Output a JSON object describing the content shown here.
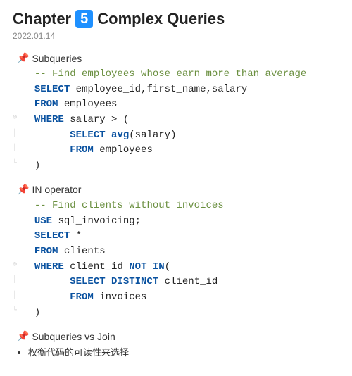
{
  "title": {
    "prefix": "Chapter",
    "number": "5",
    "suffix": "Complex Queries"
  },
  "date": "2022.01.14",
  "sections": {
    "s1": {
      "heading": "Subqueries",
      "code_html": "  <span class=\"cmt\">-- Find employees whose earn more than average</span>\n  <span class=\"kw\">SELECT</span> <span class=\"id\">employee_id,first_name,salary</span>\n  <span class=\"kw\">FROM</span> <span class=\"id\">employees</span>\n<span class=\"gutter\">⊖</span>  <span class=\"kw\">WHERE</span> <span class=\"id\">salary &gt; (</span>\n<span class=\"gutter\">│</span>        <span class=\"kw\">SELECT</span> <span class=\"kw\">avg</span><span class=\"id\">(salary)</span>\n<span class=\"gutter\">│</span>        <span class=\"kw\">FROM</span> <span class=\"id\">employees</span>\n<span class=\"gutter\">└</span>  <span class=\"id\">)</span>"
    },
    "s2": {
      "heading": "IN operator",
      "code_html": "  <span class=\"cmt\">-- Find clients without invoices</span>\n  <span class=\"kw\">USE</span> <span class=\"id\">sql_invoicing;</span>\n  <span class=\"kw\">SELECT</span> <span class=\"id\">*</span>\n  <span class=\"kw\">FROM</span> <span class=\"id\">clients</span>\n<span class=\"gutter\">⊖</span>  <span class=\"kw\">WHERE</span> <span class=\"id\">client_id</span> <span class=\"kw\">NOT IN</span><span class=\"id\">(</span>\n<span class=\"gutter\">│</span>        <span class=\"kw\">SELECT DISTINCT</span> <span class=\"id\">client_id</span>\n<span class=\"gutter\">│</span>        <span class=\"kw\">FROM</span> <span class=\"id\">invoices</span>\n<span class=\"gutter\">└</span>  <span class=\"id\">)</span>"
    },
    "s3": {
      "heading": "Subqueries vs Join",
      "bullet": "权衡代码的可读性来选择"
    }
  }
}
